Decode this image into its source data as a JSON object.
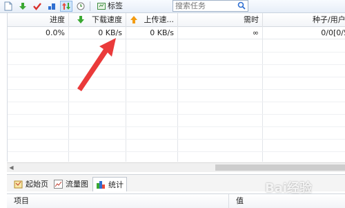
{
  "toolbar": {
    "tag_label": "标签",
    "search_placeholder": "搜索任务"
  },
  "columns": [
    {
      "label": "进度"
    },
    {
      "label": "下载速度"
    },
    {
      "label": "上传速..."
    },
    {
      "label": "需时"
    },
    {
      "label": "种子/用户["
    }
  ],
  "rows": [
    {
      "progress": "0.0%",
      "down_speed": "0 KB/s",
      "up_speed": "0 KB/s",
      "eta": "∞",
      "seeds_peers": "0/0[0/5"
    }
  ],
  "tabs": [
    {
      "label": "起始页"
    },
    {
      "label": "流量图"
    },
    {
      "label": "统计"
    }
  ],
  "stats": {
    "col_item": "项目",
    "col_value": "值"
  },
  "colors": {
    "annotation_arrow": "#ea3a3a",
    "down_arrow": "#3aa832",
    "up_arrow": "#f39c12"
  },
  "watermark": "Bai经验"
}
